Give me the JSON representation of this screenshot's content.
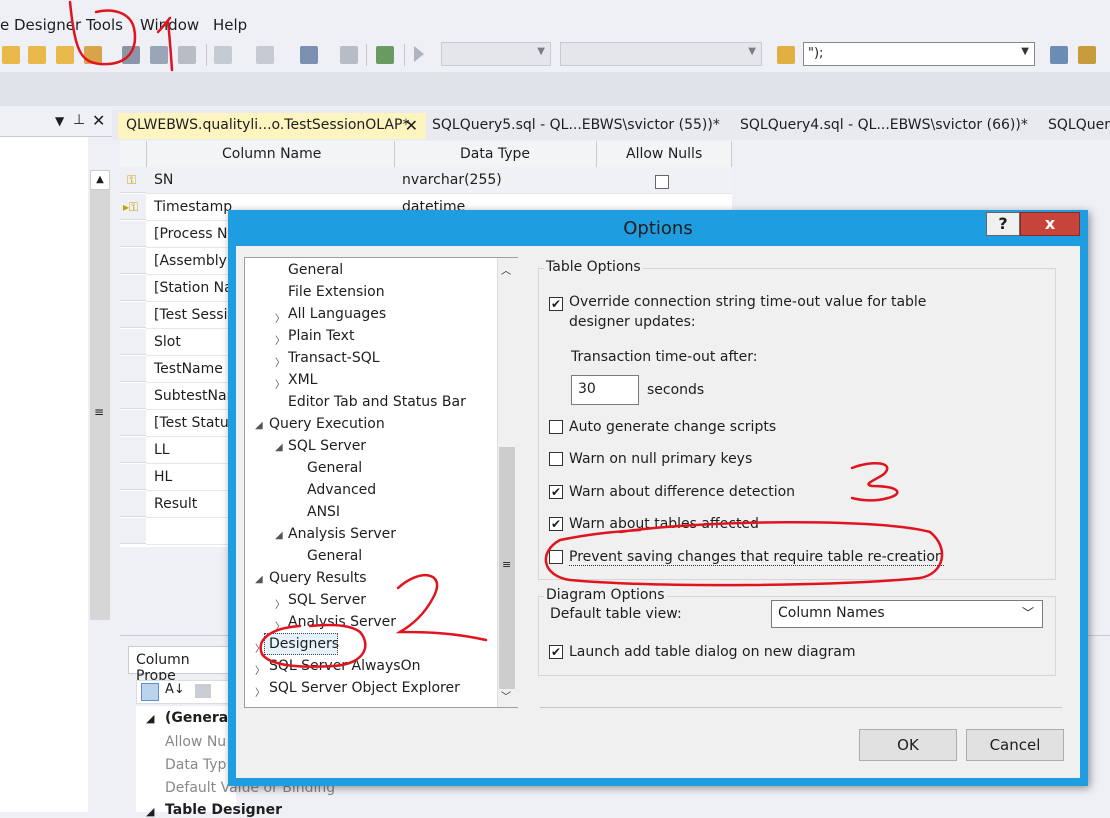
{
  "menu": {
    "designer": "e Designer",
    "tools": "Tools",
    "window": "Window",
    "help": "Help"
  },
  "toolbar": {
    "sql_combo_value": "\");"
  },
  "tabs": [
    {
      "label": "QLWEBWS.qualityli...o.TestSessionOLAP*",
      "active": true
    },
    {
      "label": "SQLQuery5.sql - QL...EBWS\\svictor (55))*"
    },
    {
      "label": "SQLQuery4.sql - QL...EBWS\\svictor (66))*"
    },
    {
      "label": "SQLQuery"
    }
  ],
  "grid": {
    "headers": [
      "Column Name",
      "Data Type",
      "Allow Nulls"
    ],
    "rows": [
      {
        "name": "SN",
        "type": "nvarchar(255)"
      },
      {
        "name": "Timestamp",
        "type": "datetime"
      },
      {
        "name": "[Process Na"
      },
      {
        "name": "[Assembly"
      },
      {
        "name": "[Station Na"
      },
      {
        "name": "[Test Sessio"
      },
      {
        "name": "Slot"
      },
      {
        "name": "TestName"
      },
      {
        "name": "SubtestNar"
      },
      {
        "name": "[Test Status"
      },
      {
        "name": "LL"
      },
      {
        "name": "HL"
      },
      {
        "name": "Result"
      }
    ]
  },
  "column_properties": {
    "tab_label": "Column Prope",
    "section_general": "(General)",
    "prop_allow_nulls": "Allow Nu",
    "prop_data_type": "Data Typ",
    "prop_default": "Default Value or Binding",
    "section_table_designer": "Table Designer"
  },
  "dialog": {
    "title": "Options",
    "help_label": "?",
    "close_label": "x",
    "tree": [
      {
        "label": "General"
      },
      {
        "label": "File Extension"
      },
      {
        "label": "All Languages"
      },
      {
        "label": "Plain Text"
      },
      {
        "label": "Transact-SQL"
      },
      {
        "label": "XML"
      },
      {
        "label": "Editor Tab and Status Bar"
      },
      {
        "label": "Query Execution"
      },
      {
        "label": "SQL Server"
      },
      {
        "label": "General"
      },
      {
        "label": "Advanced"
      },
      {
        "label": "ANSI"
      },
      {
        "label": "Analysis Server"
      },
      {
        "label": "General"
      },
      {
        "label": "Query Results"
      },
      {
        "label": "SQL Server"
      },
      {
        "label": "Analysis Server"
      },
      {
        "label": "Designers"
      },
      {
        "label": "SQL Server AlwaysOn"
      },
      {
        "label": "SQL Server Object Explorer"
      }
    ],
    "table_options": {
      "group_label": "Table Options",
      "override_timeout": {
        "label_line1": "Override connection string time-out value for table",
        "label_line2": "designer updates:",
        "checked": true
      },
      "transaction_timeout_label": "Transaction time-out after:",
      "timeout_value": "30",
      "seconds_label": "seconds",
      "auto_generate": {
        "label": "Auto generate change scripts",
        "checked": false
      },
      "warn_null_pk": {
        "label": "Warn on null primary keys",
        "checked": false
      },
      "warn_difference": {
        "label": "Warn about difference detection",
        "checked": true
      },
      "warn_tables": {
        "label": "Warn about tables affected",
        "checked": true
      },
      "prevent_saving": {
        "label": "Prevent saving changes that require table re-creation",
        "checked": false
      }
    },
    "diagram_options": {
      "group_label": "Diagram Options",
      "default_view_label": "Default table view:",
      "default_view_value": "Column Names",
      "launch_add_table": {
        "label": "Launch add table dialog on new diagram",
        "checked": true
      }
    },
    "ok_label": "OK",
    "cancel_label": "Cancel"
  },
  "annotation_color": "#e0141e",
  "annotation_labels": [
    "1",
    "2",
    "3"
  ]
}
